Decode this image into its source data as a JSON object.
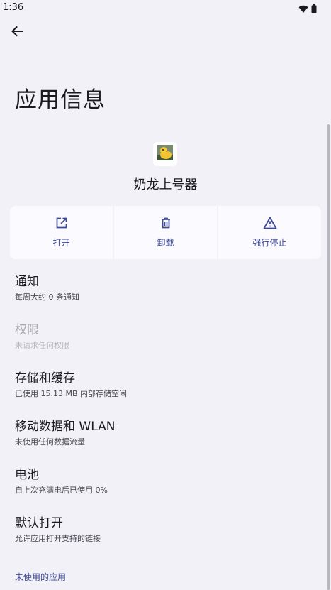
{
  "status_bar": {
    "time": "1:36",
    "icons": [
      "wifi-icon",
      "battery-icon"
    ]
  },
  "header": {
    "back_icon": "arrow-back-icon",
    "title": "应用信息"
  },
  "app": {
    "name": "奶龙上号器",
    "icon": "duck-app-icon"
  },
  "actions": [
    {
      "label": "打开",
      "icon": "open-external-icon"
    },
    {
      "label": "卸载",
      "icon": "trash-icon"
    },
    {
      "label": "强行停止",
      "icon": "warning-icon"
    }
  ],
  "items": [
    {
      "title": "通知",
      "subtitle": "每周大约 0 条通知",
      "enabled": true
    },
    {
      "title": "权限",
      "subtitle": "未请求任何权限",
      "enabled": false
    },
    {
      "title": "存储和缓存",
      "subtitle": "已使用 15.13 MB 内部存储空间",
      "enabled": true
    },
    {
      "title": "移动数据和 WLAN",
      "subtitle": "未使用任何数据流量",
      "enabled": true
    },
    {
      "title": "电池",
      "subtitle": "自上次充满电后已使用 0%",
      "enabled": true
    },
    {
      "title": "默认打开",
      "subtitle": "允许应用打开支持的链接",
      "enabled": true
    }
  ],
  "section_link": "未使用的应用",
  "colors": {
    "background": "#f3f1f8",
    "accent": "#3f4a96",
    "card": "#fbfaff"
  }
}
